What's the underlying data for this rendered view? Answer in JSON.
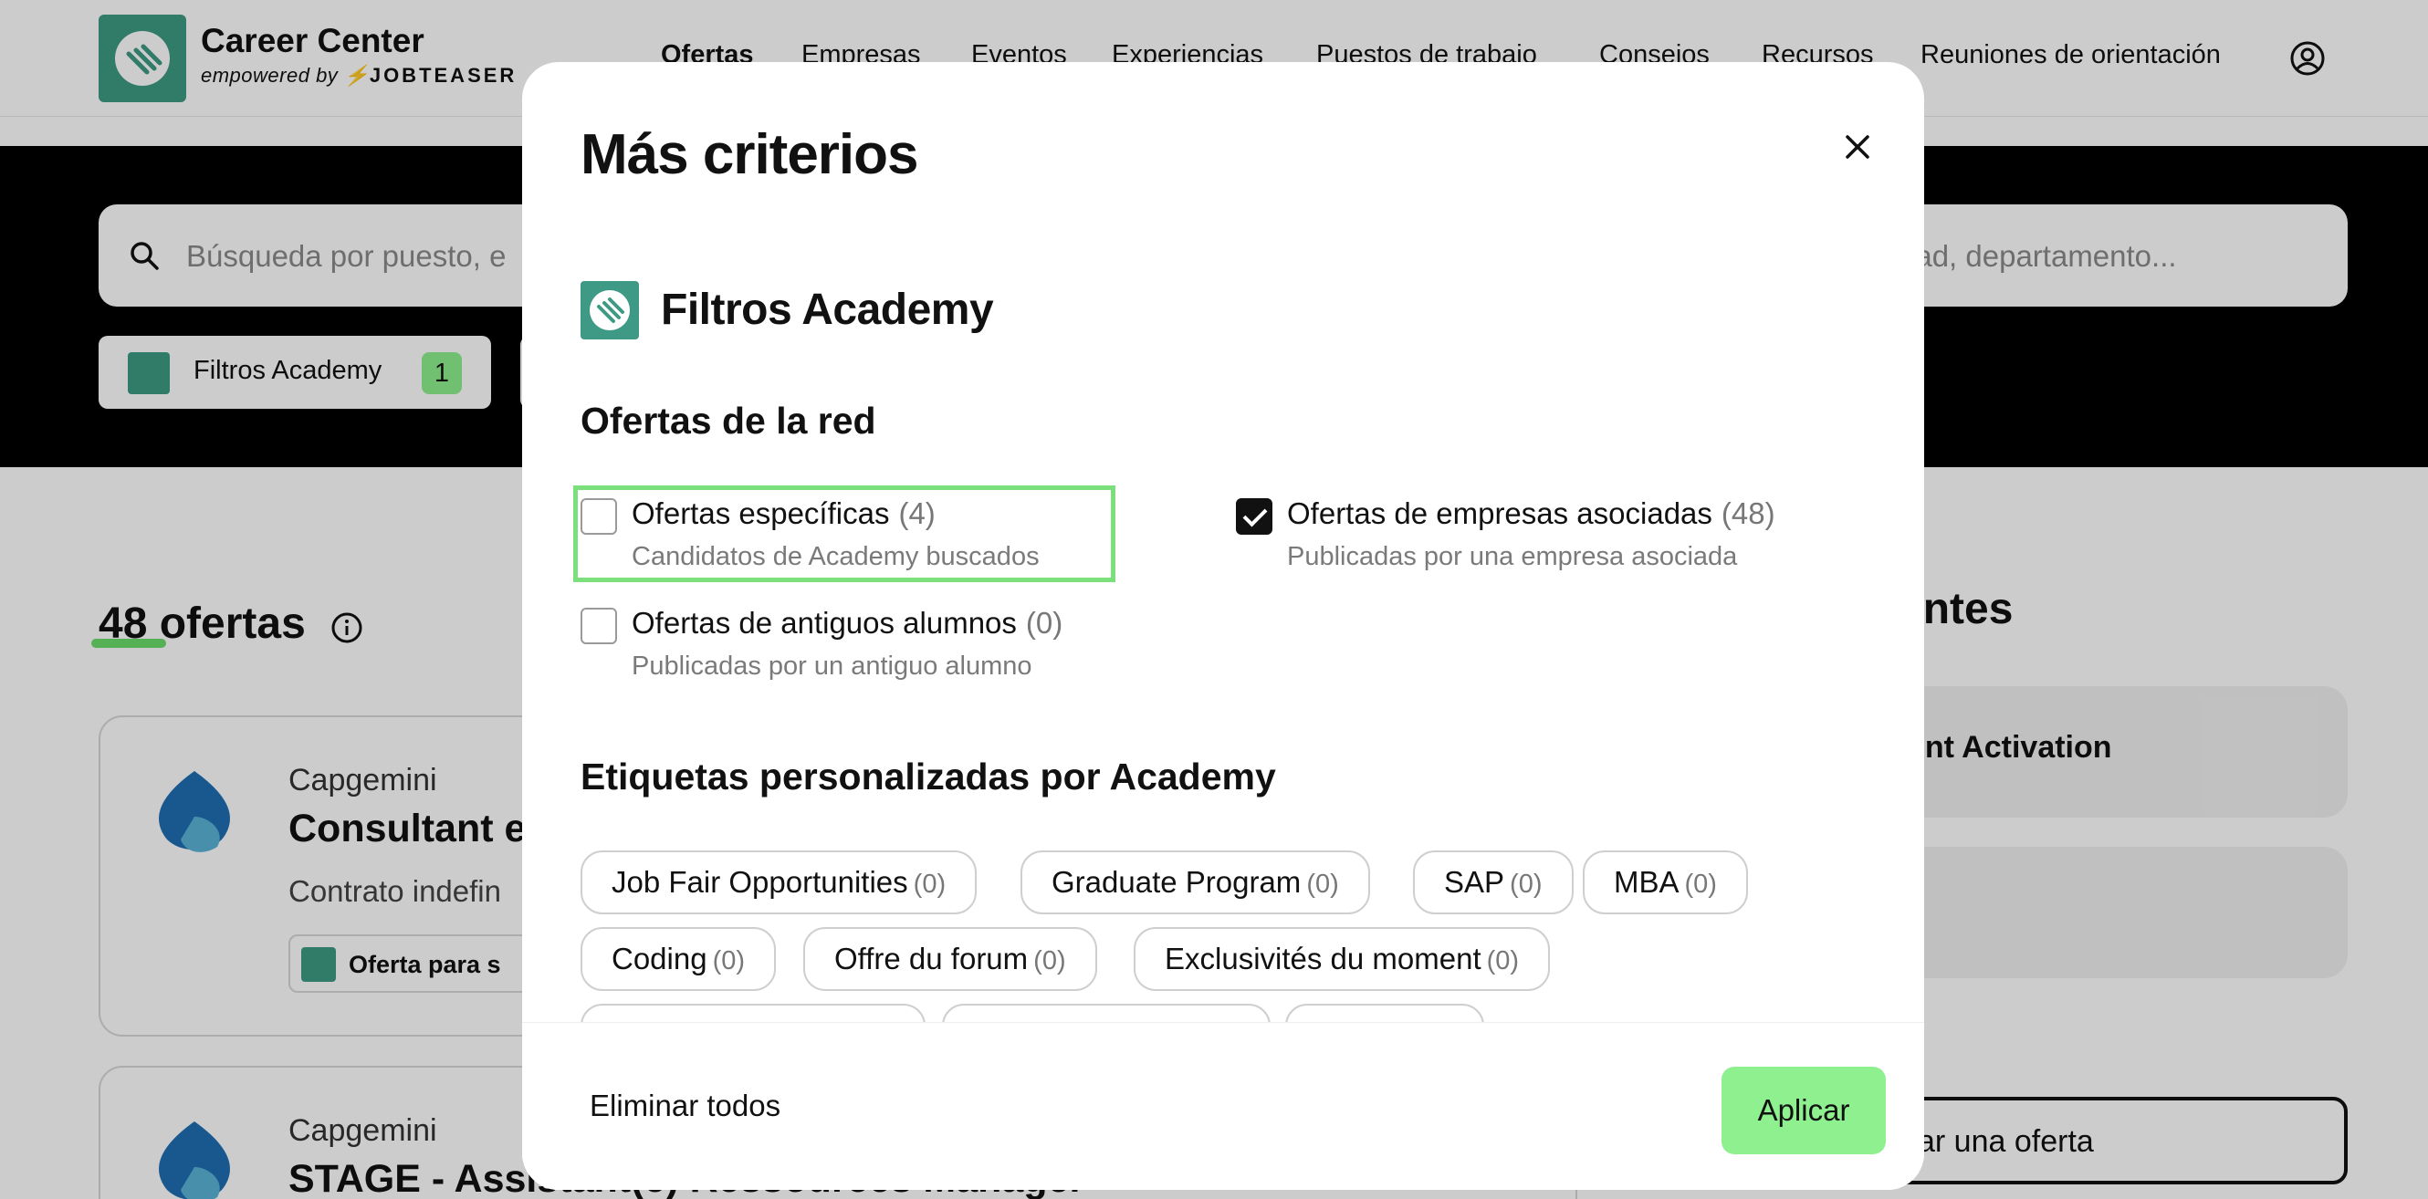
{
  "header": {
    "logo_title": "Career Center",
    "logo_sub_prefix": "empowered by",
    "logo_sub_brand": "JOBTEASER",
    "nav": [
      "Ofertas",
      "Empresas",
      "Eventos",
      "Experiencias",
      "Puestos de trabajo",
      "Consejos",
      "Recursos",
      "Reuniones de orientación"
    ],
    "active_nav": "Ofertas"
  },
  "search": {
    "placeholder_left": "Búsqueda por puesto, e",
    "placeholder_right": "dad, departamento..."
  },
  "filter_chip": {
    "label": "Filtros Academy",
    "count": "1"
  },
  "results": {
    "count_text": "48 ofertas"
  },
  "cards": [
    {
      "company": "Capgemini",
      "title": "Consultant e",
      "contract": "Contrato indefin",
      "tag": "Oferta para s"
    },
    {
      "company": "Capgemini",
      "title": "STAGE - Assistant(e) Ressources Manager"
    }
  ],
  "sidebar": {
    "recent_title": "cientes",
    "recent_items": [
      "ent Activation",
      ""
    ],
    "publish_button": "car una oferta"
  },
  "modal": {
    "title": "Más criterios",
    "section_title": "Filtros Academy",
    "network_heading": "Ofertas de la red",
    "options": [
      {
        "label": "Ofertas específicas",
        "count": "(4)",
        "description": "Candidatos de Academy buscados",
        "checked": false
      },
      {
        "label": "Ofertas de empresas asociadas",
        "count": "(48)",
        "description": "Publicadas por una empresa asociada",
        "checked": true
      },
      {
        "label": "Ofertas de antiguos alumnos",
        "count": "(0)",
        "description": "Publicadas por un antiguo alumno",
        "checked": false
      }
    ],
    "tags_heading": "Etiquetas personalizadas por Academy",
    "tags": [
      {
        "label": "Job Fair Opportunities",
        "count": "(0)"
      },
      {
        "label": "Graduate Program",
        "count": "(0)"
      },
      {
        "label": "SAP",
        "count": "(0)"
      },
      {
        "label": "MBA",
        "count": "(0)"
      },
      {
        "label": "Coding",
        "count": "(0)"
      },
      {
        "label": "Offre du forum",
        "count": "(0)"
      },
      {
        "label": "Exclusivités du moment",
        "count": "(0)"
      }
    ],
    "footer": {
      "clear_label": "Eliminar todos",
      "apply_label": "Aplicar"
    }
  },
  "colors": {
    "accent_green": "#8ef08e",
    "academy_teal": "#3e9a84",
    "highlight_green": "#7be07b"
  },
  "icons": [
    "academy-logo-icon",
    "user-icon",
    "search-icon",
    "info-icon",
    "close-icon",
    "checkbox-icon",
    "capgemini-logo"
  ]
}
